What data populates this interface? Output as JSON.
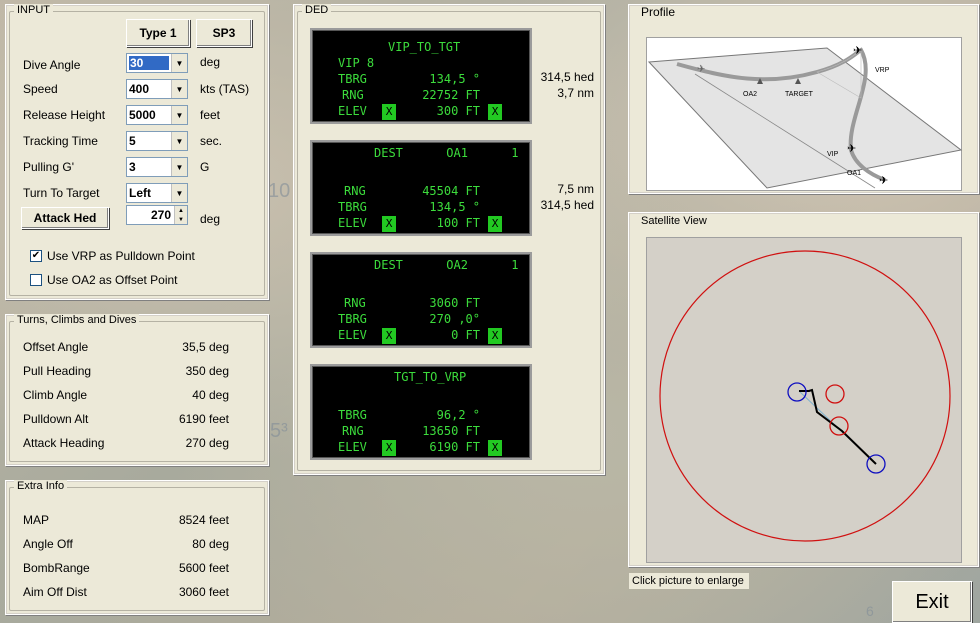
{
  "background_marks": [
    "10",
    "5³",
    "6"
  ],
  "input": {
    "title": "INPUT",
    "type1_label": "Type 1",
    "sp3_label": "SP3",
    "rows": [
      {
        "label": "Dive Angle",
        "value": "30",
        "unit": "deg"
      },
      {
        "label": "Speed",
        "value": "400",
        "unit": "kts (TAS)"
      },
      {
        "label": "Release Height",
        "value": "5000",
        "unit": "feet"
      },
      {
        "label": "Tracking Time",
        "value": "5",
        "unit": "sec."
      },
      {
        "label": "Pulling G'",
        "value": "3",
        "unit": "G"
      },
      {
        "label": "Turn To Target",
        "value": "Left",
        "unit": ""
      }
    ],
    "attack_hed_label": "Attack Hed",
    "attack_hed_value": "270",
    "attack_hed_unit": "deg",
    "use_vrp_label": "Use VRP as Pulldown Point",
    "use_vrp_checked": true,
    "use_oa2_label": "Use OA2 as Offset Point",
    "use_oa2_checked": false
  },
  "turns": {
    "title": "Turns, Climbs and Dives",
    "rows": [
      {
        "label": "Offset Angle",
        "value": "35,5 deg"
      },
      {
        "label": "Pull Heading",
        "value": "350 deg"
      },
      {
        "label": "Climb Angle",
        "value": "40 deg"
      },
      {
        "label": "Pulldown Alt",
        "value": "6190 feet"
      },
      {
        "label": "Attack Heading",
        "value": "270 deg"
      }
    ]
  },
  "extra": {
    "title": "Extra Info",
    "rows": [
      {
        "label": "MAP",
        "value": "8524 feet"
      },
      {
        "label": "Angle Off",
        "value": "80 deg"
      },
      {
        "label": "BombRange",
        "value": "5600 feet"
      },
      {
        "label": "Aim Off Dist",
        "value": "3060 feet"
      }
    ]
  },
  "ded": {
    "title": "DED",
    "x_label": "X",
    "screens": [
      {
        "header": "VIP_TO_TGT",
        "sub": "VIP 8",
        "tbrg_label": "TBRG",
        "tbrg": "134,5 °",
        "rng_label": "RNG",
        "rng": "22752 FT",
        "elev_label": "ELEV",
        "elev": "300 FT",
        "side1": "314,5 hed",
        "side2": "3,7 nm"
      },
      {
        "header": "DEST      OA1      1",
        "rng_label": "RNG",
        "rng": "45504 FT",
        "tbrg_label": "TBRG",
        "tbrg": "134,5 °",
        "elev_label": "ELEV",
        "elev": "100 FT",
        "side1": "7,5 nm",
        "side2": "314,5 hed"
      },
      {
        "header": "DEST      OA2      1",
        "rng_label": "RNG",
        "rng": "3060 FT",
        "tbrg_label": "TBRG",
        "tbrg": "270 ,0°",
        "elev_label": "ELEV",
        "elev": "0 FT"
      },
      {
        "header": "TGT_TO_VRP",
        "tbrg_label": "TBRG",
        "tbrg": "96,2 °",
        "rng_label": "RNG",
        "rng": "13650 FT",
        "elev_label": "ELEV",
        "elev": "6190 FT"
      }
    ]
  },
  "profile": {
    "title": "Profile",
    "labels": {
      "vrp": "VRP",
      "oa2": "OA2",
      "target": "TARGET",
      "vip": "VIP",
      "oa1": "OA1"
    }
  },
  "satellite": {
    "title": "Satellite View"
  },
  "hint": "Click picture to enlarge",
  "exit_label": "Exit",
  "colors": {
    "ded_green": "#3cdc3c",
    "x_green": "#22c922",
    "panel": "#ece9d8",
    "circle_red": "#d01010",
    "circle_blue": "#1010c0"
  }
}
